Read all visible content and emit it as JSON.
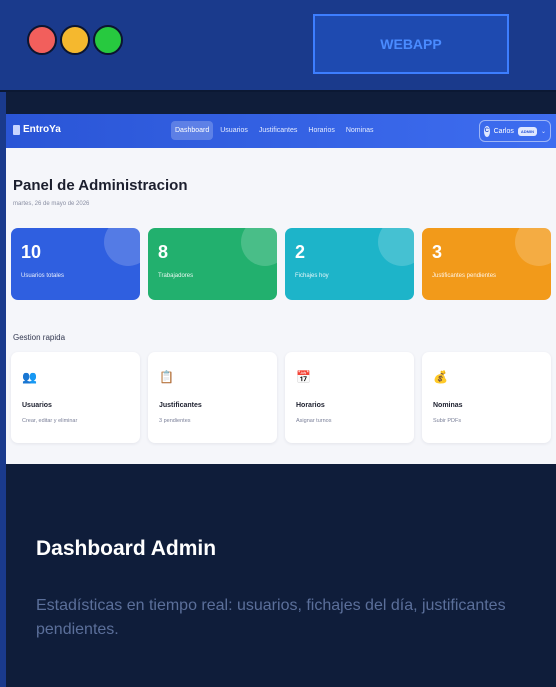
{
  "window": {
    "title_button": "WEBAPP",
    "colors": {
      "red": "#f25f5c",
      "yellow": "#f5b82e",
      "green": "#27c93f",
      "accent": "#3d7eff"
    }
  },
  "app": {
    "brand": "EntroYa",
    "brand_icon": "building-icon",
    "nav": [
      "Dashboard",
      "Usuarios",
      "Justificantes",
      "Horarios",
      "Nominas"
    ],
    "active_nav": "Dashboard",
    "user": {
      "initial": "C",
      "name": "Carlos",
      "role": "ADMIN"
    }
  },
  "page": {
    "title": "Panel de Administracion",
    "date": "martes, 26 de mayo de 2026"
  },
  "stats": [
    {
      "value": "10",
      "label": "Usuarios totales",
      "color": "#2f5fe0"
    },
    {
      "value": "8",
      "label": "Trabajadores",
      "color": "#22b06e"
    },
    {
      "value": "2",
      "label": "Fichajes hoy",
      "color": "#1db4c9"
    },
    {
      "value": "3",
      "label": "Justificantes pendientes",
      "color": "#f29a1a"
    }
  ],
  "quick": {
    "title": "Gestion rapida",
    "items": [
      {
        "icon": "users-icon",
        "glyph": "👥",
        "title": "Usuarios",
        "subtitle": "Crear, editar y eliminar"
      },
      {
        "icon": "clipboard-icon",
        "glyph": "📋",
        "title": "Justificantes",
        "subtitle": "3 pendientes"
      },
      {
        "icon": "calendar-icon",
        "glyph": "📅",
        "title": "Horarios",
        "subtitle": "Asignar turnos"
      },
      {
        "icon": "money-bag-icon",
        "glyph": "💰",
        "title": "Nominas",
        "subtitle": "Subir PDFs"
      }
    ]
  },
  "caption": {
    "title": "Dashboard Admin",
    "text": "Estadísticas en tiempo real: usuarios, fichajes del día, justificantes pendientes."
  }
}
